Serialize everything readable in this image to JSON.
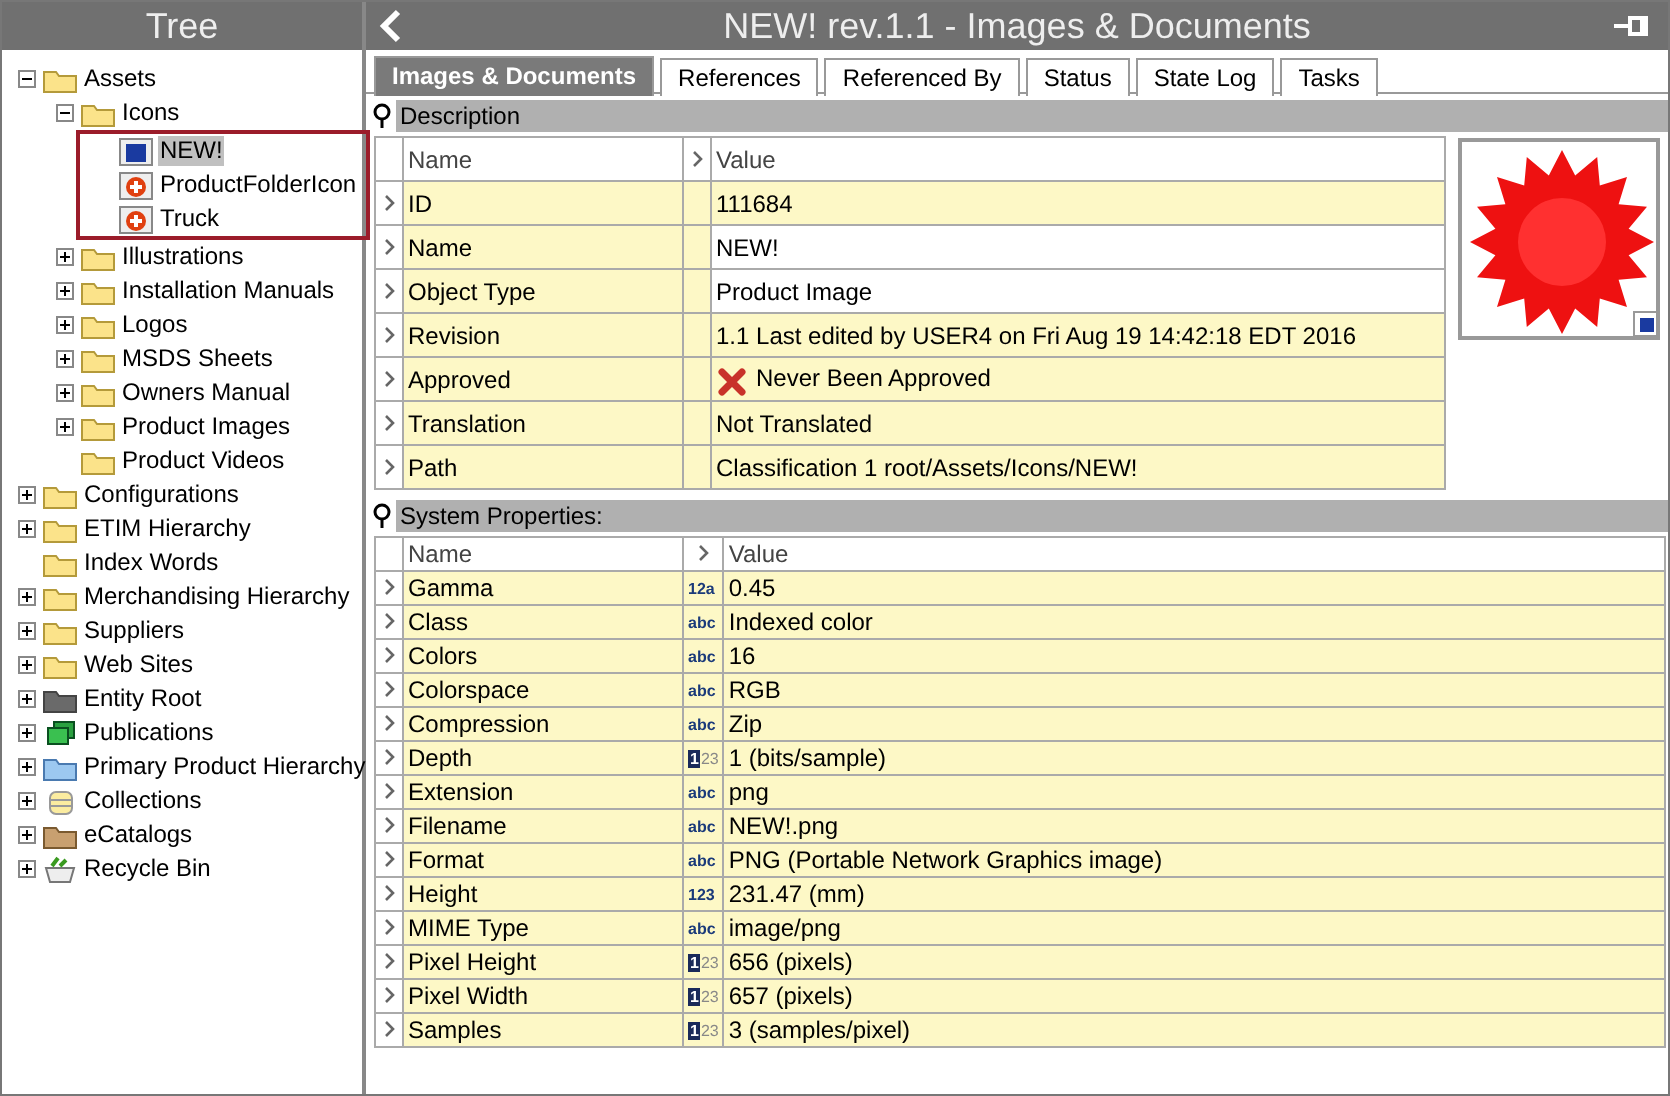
{
  "tree": {
    "title": "Tree",
    "items": [
      {
        "label": "Assets",
        "kind": "folder",
        "expanded": true,
        "children": [
          {
            "label": "Icons",
            "kind": "folder",
            "expanded": true,
            "boxed": true,
            "children": [
              {
                "label": "NEW!",
                "kind": "asset-blue",
                "selected": true
              },
              {
                "label": "ProductFolderIcon",
                "kind": "asset-red",
                "selected": false
              },
              {
                "label": "Truck",
                "kind": "asset-red",
                "selected": false
              }
            ]
          },
          {
            "label": "Illustrations",
            "kind": "folder",
            "expanded": false
          },
          {
            "label": "Installation Manuals",
            "kind": "folder",
            "expanded": false
          },
          {
            "label": "Logos",
            "kind": "folder",
            "expanded": false
          },
          {
            "label": "MSDS Sheets",
            "kind": "folder",
            "expanded": false
          },
          {
            "label": "Owners Manual",
            "kind": "folder",
            "expanded": false
          },
          {
            "label": "Product Images",
            "kind": "folder",
            "expanded": false
          },
          {
            "label": "Product Videos",
            "kind": "folder"
          }
        ]
      },
      {
        "label": "Configurations",
        "kind": "folder",
        "expanded": false
      },
      {
        "label": "ETIM Hierarchy",
        "kind": "folder",
        "expanded": false
      },
      {
        "label": "Index Words",
        "kind": "folder"
      },
      {
        "label": "Merchandising Hierarchy",
        "kind": "folder",
        "expanded": false
      },
      {
        "label": "Suppliers",
        "kind": "folder",
        "expanded": false
      },
      {
        "label": "Web Sites",
        "kind": "folder",
        "expanded": false
      },
      {
        "label": "Entity Root",
        "kind": "folder-gray",
        "expanded": false
      },
      {
        "label": "Publications",
        "kind": "publications",
        "expanded": false
      },
      {
        "label": "Primary Product Hierarchy",
        "kind": "folder-blue",
        "expanded": false
      },
      {
        "label": "Collections",
        "kind": "collections",
        "expanded": false
      },
      {
        "label": "eCatalogs",
        "kind": "folder-brown",
        "expanded": false
      },
      {
        "label": "Recycle Bin",
        "kind": "recycle",
        "expanded": false
      }
    ]
  },
  "header": {
    "title": "NEW! rev.1.1 - Images & Documents"
  },
  "tabs": [
    {
      "label": "Images & Documents",
      "selected": true
    },
    {
      "label": "References",
      "selected": false
    },
    {
      "label": "Referenced By",
      "selected": false
    },
    {
      "label": "Status",
      "selected": false
    },
    {
      "label": "State Log",
      "selected": false
    },
    {
      "label": "Tasks",
      "selected": false
    }
  ],
  "description": {
    "title": "Description",
    "columns": [
      "Name",
      "Value"
    ],
    "rows": [
      {
        "name": "ID",
        "value": "111684",
        "editable": false,
        "kind": "plain"
      },
      {
        "name": "Name",
        "value": "NEW!",
        "editable": true,
        "kind": "plain"
      },
      {
        "name": "Object Type",
        "value": "Product Image",
        "editable": true,
        "kind": "plain"
      },
      {
        "name": "Revision",
        "value": "1.1 Last edited by USER4 on Fri Aug 19 14:42:18 EDT 2016",
        "editable": false,
        "kind": "plain"
      },
      {
        "name": "Approved",
        "value": "Never Been Approved",
        "editable": false,
        "kind": "rejected"
      },
      {
        "name": "Translation",
        "value": "Not Translated",
        "editable": false,
        "kind": "plain"
      },
      {
        "name": "Path",
        "value": "Classification 1 root/Assets/Icons/NEW!",
        "editable": false,
        "kind": "plain"
      }
    ],
    "preview": {
      "kind": "picture"
    }
  },
  "system_properties": {
    "title": "System Properties:",
    "columns": [
      "Name",
      "Value"
    ],
    "rows": [
      {
        "name": "Gamma",
        "type": "12a",
        "value": "0.45",
        "kind": "decimal"
      },
      {
        "name": "Class",
        "type": "abc",
        "value": "Indexed color",
        "kind": "text"
      },
      {
        "name": "Colors",
        "type": "abc",
        "value": "16",
        "kind": "text"
      },
      {
        "name": "Colorspace",
        "type": "abc",
        "value": "RGB",
        "kind": "text"
      },
      {
        "name": "Compression",
        "type": "abc",
        "value": "Zip",
        "kind": "text"
      },
      {
        "name": "Depth",
        "type": "123",
        "value": "1 (bits/sample)",
        "kind": "integer"
      },
      {
        "name": "Extension",
        "type": "abc",
        "value": "png",
        "kind": "text"
      },
      {
        "name": "Filename",
        "type": "abc",
        "value": "NEW!.png",
        "kind": "text"
      },
      {
        "name": "Format",
        "type": "abc",
        "value": "PNG (Portable Network Graphics image)",
        "kind": "text"
      },
      {
        "name": "Height",
        "type": "123",
        "value": "231.47 (mm)",
        "kind": "decimal"
      },
      {
        "name": "MIME Type",
        "type": "abc",
        "value": "image/png",
        "kind": "text"
      },
      {
        "name": "Pixel Height",
        "type": "123",
        "value": "656 (pixels)",
        "kind": "integer"
      },
      {
        "name": "Pixel Width",
        "type": "123",
        "value": "657 (pixels)",
        "kind": "integer"
      },
      {
        "name": "Samples",
        "type": "123",
        "value": "3 (samples/pixel)",
        "kind": "integer"
      }
    ]
  }
}
